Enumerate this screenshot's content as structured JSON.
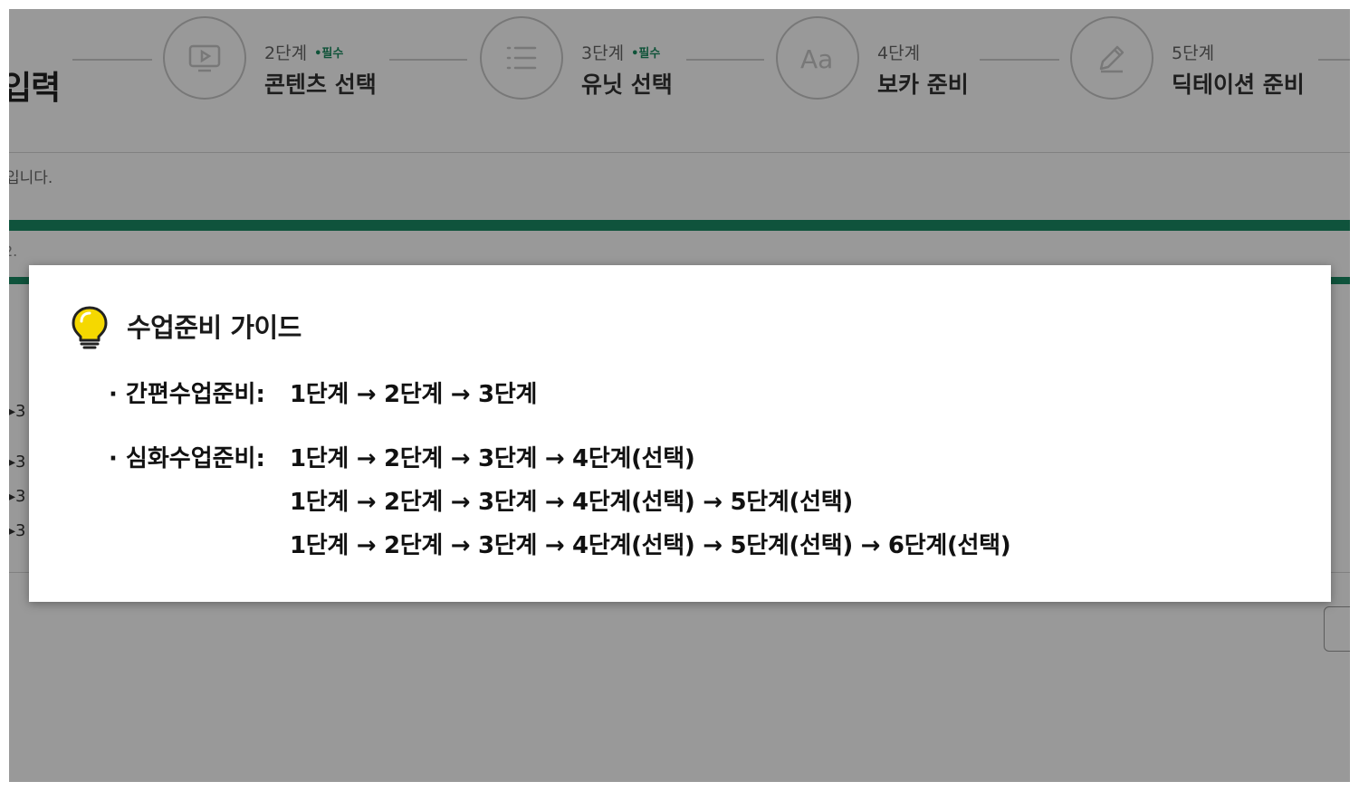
{
  "page": {
    "title_fragment": "입력",
    "subtext_fragment": "입니다.",
    "subtext2_fragment": "2.",
    "steps": [
      {
        "number": "2단계",
        "required": "•필수",
        "name": "콘텐츠 선택",
        "icon": "play-icon"
      },
      {
        "number": "3단계",
        "required": "•필수",
        "name": "유닛 선택",
        "icon": "list-icon"
      },
      {
        "number": "4단계",
        "required": "",
        "name": "보카 준비",
        "icon": "text-aa-icon"
      },
      {
        "number": "5단계",
        "required": "",
        "name": "딕테이션 준비",
        "icon": "pencil-icon"
      }
    ],
    "list_marks": [
      "3",
      "3",
      "3",
      "3"
    ],
    "colors": {
      "accent_green": "#1a8a65",
      "required_green": "#1a8a5f",
      "bulb_yellow": "#f5d800"
    }
  },
  "modal": {
    "title": "수업준비 가이드",
    "icon": "lightbulb-icon",
    "rows": [
      {
        "label": "· 간편수업준비:",
        "flows": [
          "1단계 → 2단계 → 3단계"
        ]
      },
      {
        "label": "· 심화수업준비:",
        "flows": [
          "1단계 → 2단계 → 3단계 → 4단계(선택)",
          "1단계 → 2단계 → 3단계 → 4단계(선택) → 5단계(선택)",
          "1단계 → 2단계 → 3단계 → 4단계(선택) → 5단계(선택) → 6단계(선택)"
        ]
      }
    ]
  }
}
